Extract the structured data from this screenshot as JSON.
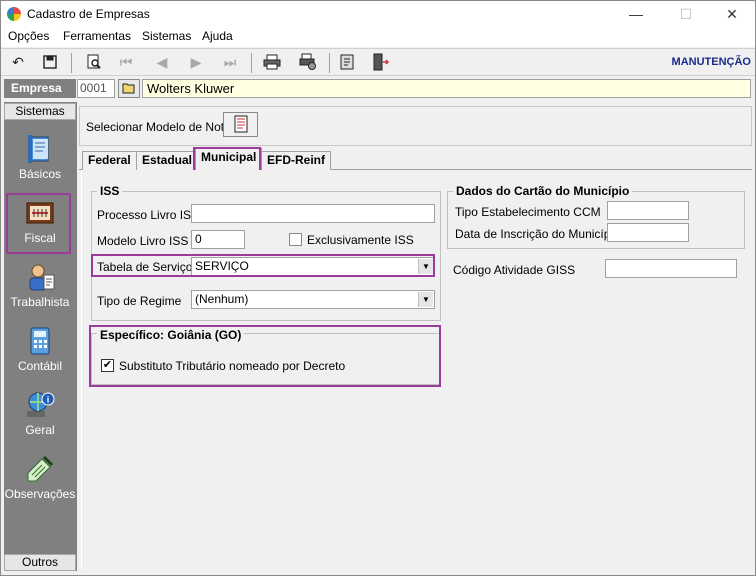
{
  "window": {
    "title": "Cadastro de Empresas",
    "controls": {
      "minimize": "—",
      "maximize": "☐",
      "close": "✕"
    }
  },
  "menu": {
    "items": [
      {
        "label": "Opções"
      },
      {
        "label": "Ferramentas"
      },
      {
        "label": "Sistemas"
      },
      {
        "label": "Ajuda"
      }
    ]
  },
  "toolbar": {
    "mode": "MANUTENÇÃO",
    "icons": [
      "undo-icon",
      "save-icon",
      "preview-icon",
      "first-icon",
      "prev-icon",
      "next-icon",
      "last-icon",
      "print-icon",
      "print-setup-icon",
      "tool-icon",
      "exit-icon"
    ]
  },
  "empresa": {
    "label": "Empresa",
    "code": "0001",
    "name": "Wolters Kluwer"
  },
  "sidebar": {
    "header": "Sistemas",
    "footer": "Outros",
    "items": [
      {
        "label": "Básicos",
        "icon": "book-icon"
      },
      {
        "label": "Fiscal",
        "icon": "ledger-icon"
      },
      {
        "label": "Trabalhista",
        "icon": "worker-icon"
      },
      {
        "label": "Contábil",
        "icon": "calculator-icon"
      },
      {
        "label": "Geral",
        "icon": "globe-info-icon"
      },
      {
        "label": "Observações",
        "icon": "notepad-icon"
      }
    ]
  },
  "modelo": {
    "label": "Selecionar Modelo de Nota"
  },
  "tabs": [
    {
      "label": "Federal"
    },
    {
      "label": "Estadual"
    },
    {
      "label": "Municipal"
    },
    {
      "label": "EFD-Reinf"
    }
  ],
  "iss": {
    "title": "ISS",
    "processo_label": "Processo Livro ISS",
    "processo_value": "",
    "modelo_label": "Modelo Livro ISS",
    "modelo_value": "0",
    "exclusivamente_label": "Exclusivamente ISS",
    "tabela_label": "Tabela de Serviços",
    "tabela_value": "SERVIÇO",
    "regime_label": "Tipo de Regime",
    "regime_value": "(Nenhum)"
  },
  "especifico": {
    "title": "Específico: Goiânia (GO)",
    "substituto_label": "Substituto Tributário nomeado por Decreto",
    "substituto_checked": "✔"
  },
  "cartao": {
    "title": "Dados do Cartão do Município",
    "ccm_label": "Tipo Estabelecimento CCM",
    "ccm_value": "",
    "inscricao_label": "Data de Inscrição do Município",
    "inscricao_value": "",
    "giss_label": "Código Atividade GISS",
    "giss_value": ""
  },
  "colors": {
    "highlight": "#9b3c9b",
    "sidebar": "#808080",
    "empresa_name_bg": "#ffffe1",
    "mode_label": "#1a2b8c"
  }
}
